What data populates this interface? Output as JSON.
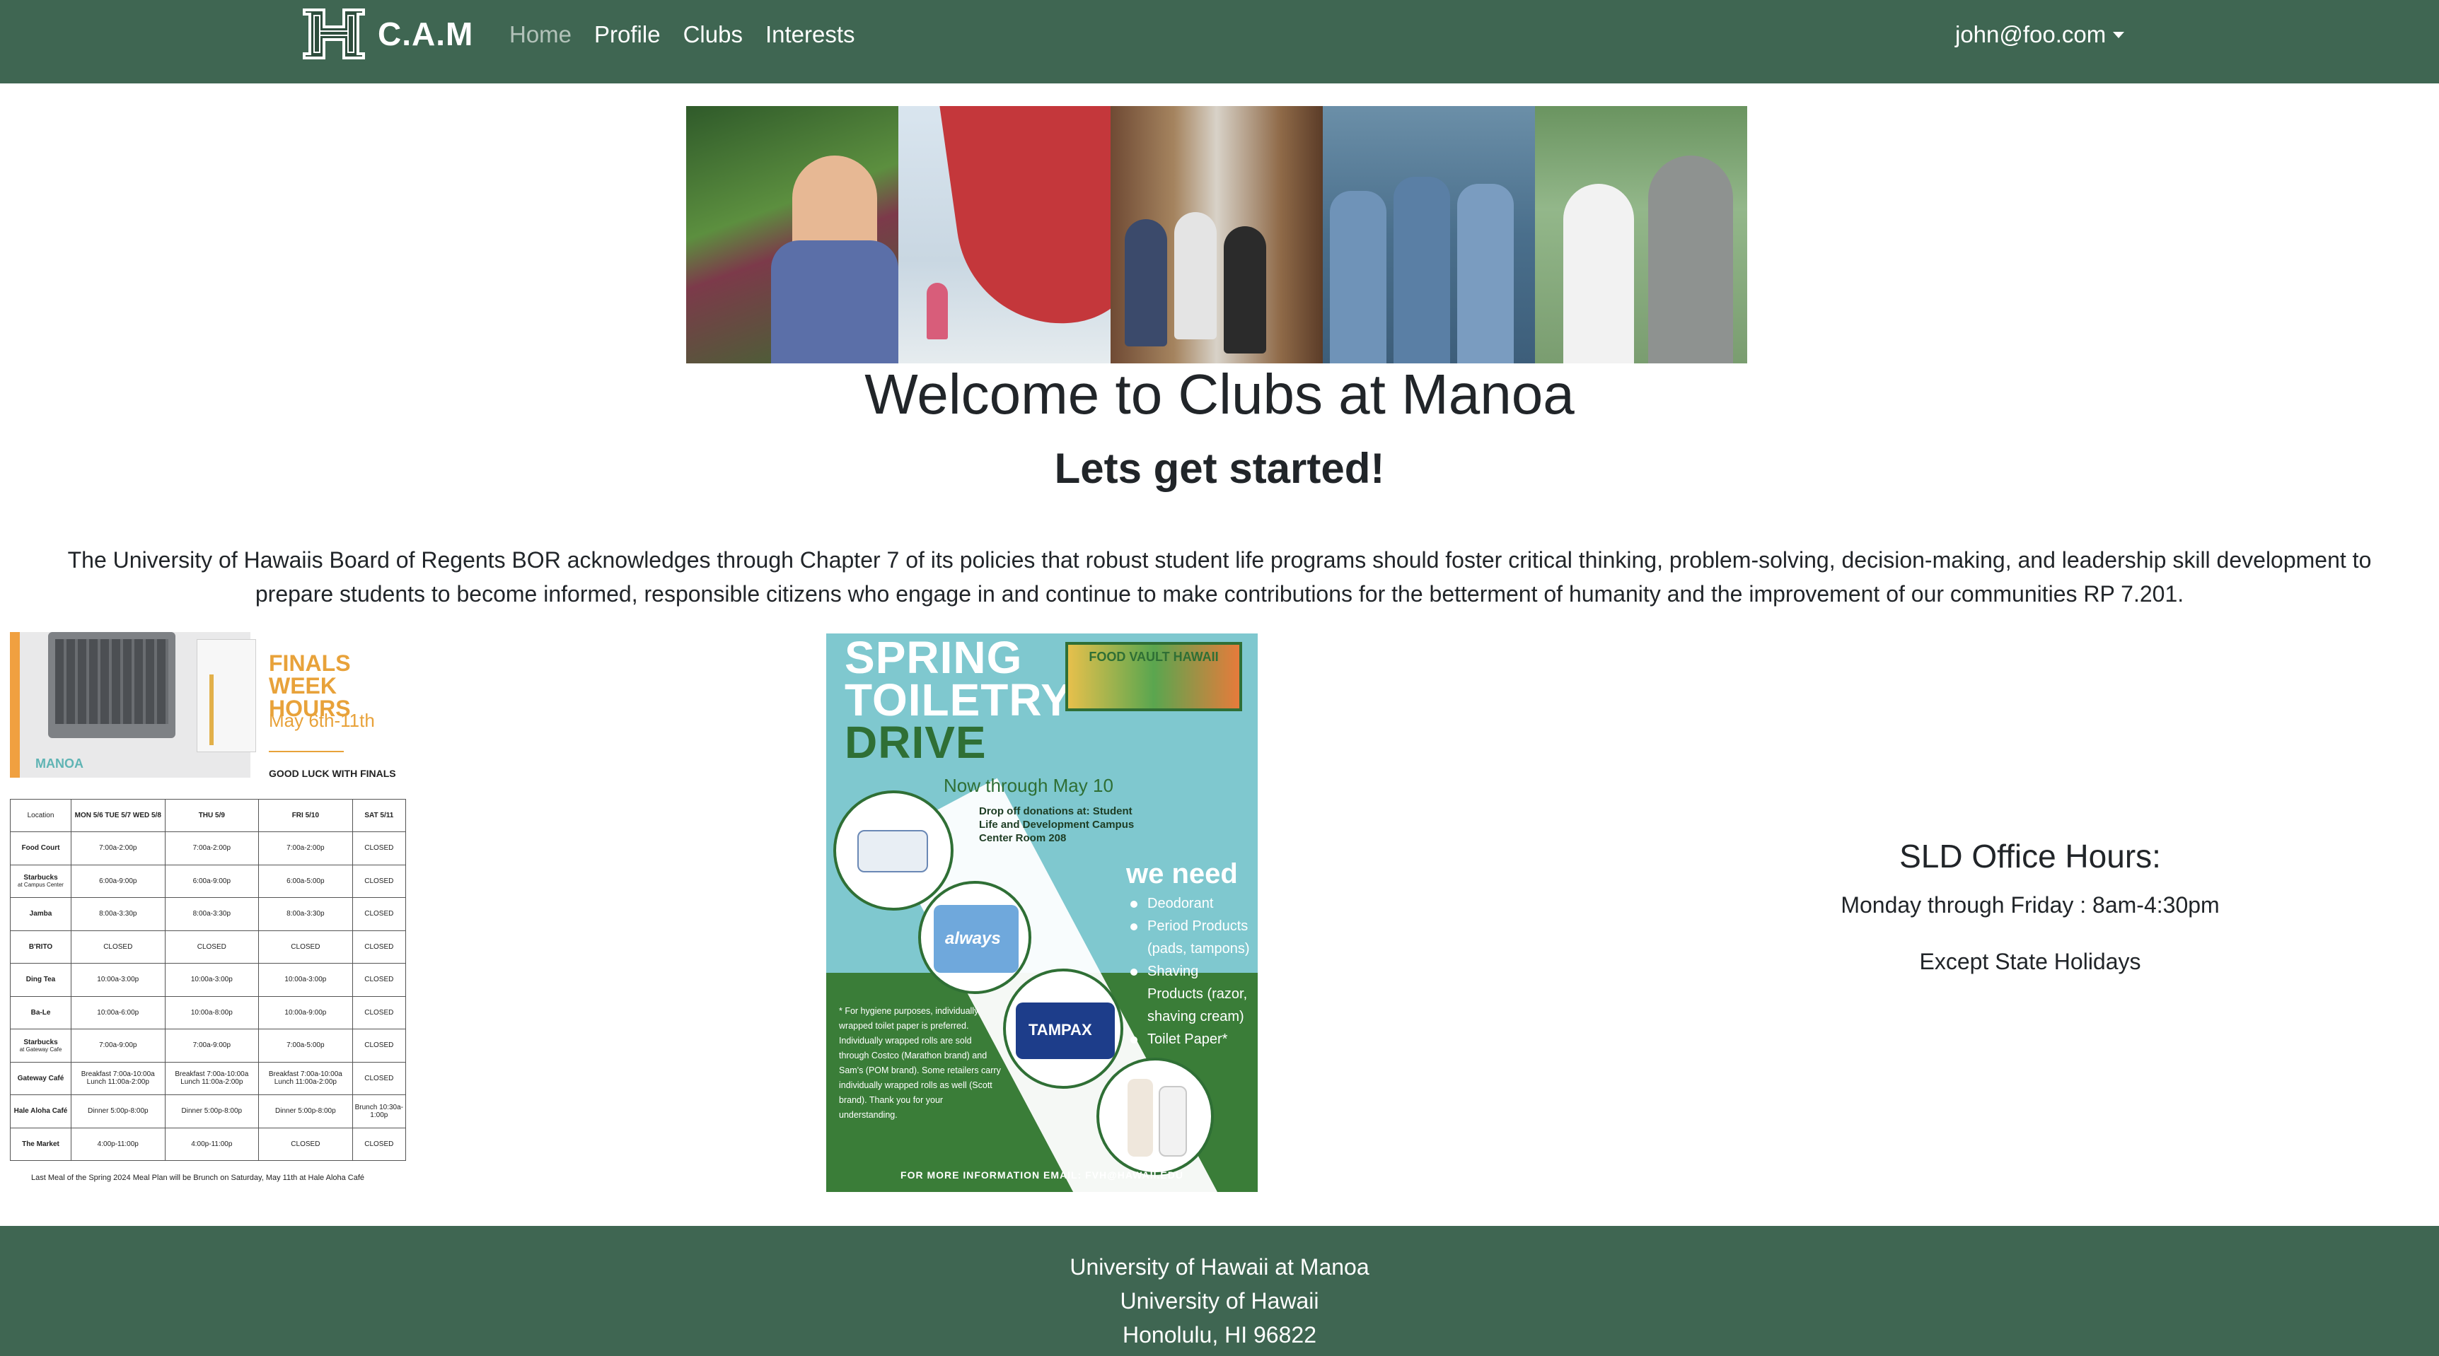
{
  "navbar": {
    "brand": "C.A.M",
    "logo_icon": "hawaii-h-logo-icon",
    "links": [
      {
        "label": "Home",
        "active": true
      },
      {
        "label": "Profile",
        "active": false
      },
      {
        "label": "Clubs",
        "active": false
      },
      {
        "label": "Interests",
        "active": false
      }
    ],
    "user": "john@foo.com",
    "bg_color": "#3f6652"
  },
  "hero": {
    "title": "Welcome to Clubs at Manoa",
    "subtitle": "Lets get started!",
    "intro": "The University of Hawaiis Board of Regents BOR acknowledges through Chapter 7 of its policies that robust student life programs should foster critical thinking, problem-solving, decision-making, and leadership skill development to prepare students to become informed, responsible citizens who engage in and continue to make contributions for the betterment of humanity and the improvement of our communities RP 7.201."
  },
  "finals_flyer": {
    "heading": "FINALS WEEK HOURS",
    "dates": "May 6th-11th",
    "good_luck": "GOOD LUCK WITH FINALS",
    "manoa_mark": "MANOA",
    "headers": [
      "Location",
      "MON 5/6 TUE 5/7 WED 5/8",
      "THU 5/9",
      "FRI 5/10",
      "SAT 5/11"
    ],
    "rows": [
      {
        "loc": "Food Court",
        "sub": "",
        "cells": [
          "7:00a-2:00p",
          "7:00a-2:00p",
          "7:00a-2:00p",
          "CLOSED"
        ]
      },
      {
        "loc": "Starbucks",
        "sub": "at Campus Center",
        "cells": [
          "6:00a-9:00p",
          "6:00a-9:00p",
          "6:00a-5:00p",
          "CLOSED"
        ]
      },
      {
        "loc": "Jamba",
        "sub": "",
        "cells": [
          "8:00a-3:30p",
          "8:00a-3:30p",
          "8:00a-3:30p",
          "CLOSED"
        ]
      },
      {
        "loc": "B'RITO",
        "sub": "",
        "cells": [
          "CLOSED",
          "CLOSED",
          "CLOSED",
          "CLOSED"
        ]
      },
      {
        "loc": "Ding Tea",
        "sub": "",
        "cells": [
          "10:00a-3:00p",
          "10:00a-3:00p",
          "10:00a-3:00p",
          "CLOSED"
        ]
      },
      {
        "loc": "Ba-Le",
        "sub": "",
        "cells": [
          "10:00a-6:00p",
          "10:00a-8:00p",
          "10:00a-9:00p",
          "CLOSED"
        ]
      },
      {
        "loc": "Starbucks",
        "sub": "at Gateway Cafe",
        "cells": [
          "7:00a-9:00p",
          "7:00a-9:00p",
          "7:00a-5:00p",
          "CLOSED"
        ]
      },
      {
        "loc": "Gateway Café",
        "sub": "",
        "cells": [
          "Breakfast 7:00a-10:00a Lunch 11:00a-2:00p",
          "Breakfast 7:00a-10:00a Lunch 11:00a-2:00p",
          "Breakfast 7:00a-10:00a Lunch 11:00a-2:00p",
          "CLOSED"
        ]
      },
      {
        "loc": "Hale Aloha Café",
        "sub": "",
        "cells": [
          "Dinner 5:00p-8:00p",
          "Dinner 5:00p-8:00p",
          "Dinner 5:00p-8:00p",
          "Brunch 10:30a-1:00p"
        ]
      },
      {
        "loc": "The Market",
        "sub": "",
        "cells": [
          "4:00p-11:00p",
          "4:00p-11:00p",
          "CLOSED",
          "CLOSED"
        ]
      }
    ],
    "note": "Last Meal of the Spring 2024 Meal Plan will be Brunch on Saturday, May 11th at Hale Aloha Café"
  },
  "drive_flyer": {
    "title_1": "SPRING",
    "title_2": "TOILETRY",
    "title_3": "DRIVE",
    "food_vault": "FOOD VAULT HAWAII",
    "now_through": "Now through May 10",
    "dropoff": "Drop off donations at: Student Life and Development Campus Center Room 208",
    "we_need": "we need",
    "needs": [
      "Deodorant",
      "Period Products (pads, tampons)",
      "Shaving Products (razor, shaving cream)",
      "Toilet Paper*"
    ],
    "hygiene_note": "* For hygiene purposes, individually wrapped toilet paper is preferred. Individually wrapped rolls are sold through Costco (Marathon brand) and Sam's (POM brand). Some retailers carry individually wrapped rolls as well (Scott brand). Thank you for your understanding.",
    "footer": "FOR MORE INFORMATION EMAIL: FVH@HAWAII.EDU",
    "product_labels": [
      "always",
      "TAMPAX"
    ]
  },
  "office_hours": {
    "title": "SLD Office Hours:",
    "days": "Monday through Friday : 8am-4:30pm",
    "note": "Except State Holidays"
  },
  "footer": {
    "line1": "University of Hawaii at Manoa",
    "line2": "University of Hawaii",
    "line3": "Honolulu, HI 96822"
  }
}
